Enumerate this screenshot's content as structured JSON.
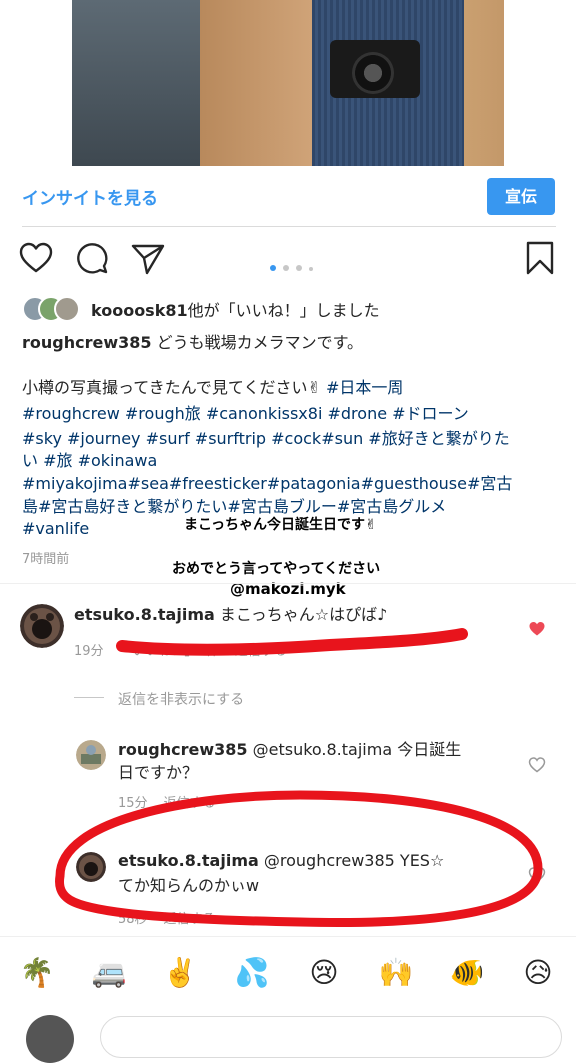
{
  "post": {
    "insights_label": "インサイトを見る",
    "promote_label": "宣伝",
    "liked_by_user": "koooosk81",
    "liked_by_suffix": "他が「いいね！」しました",
    "caption_user": "roughcrew385",
    "caption_first": " どうも戦場カメラマンです。",
    "caption_lines": [
      "小樽の写真撮ってきたんで見てください✌︎ ",
      "#日本一周",
      "#roughcrew #rough旅 #canonkissx8i #drone #ドローン",
      "#sky #journey #surf #surftrip #cock#sun #旅好きと繋がりた",
      "い #旅 #okinawa",
      "#miyakojima#sea#freesticker#patagonia#guesthouse#宮古",
      "島#宮古島好きと繋がりたい#宮古島ブルー#宮古島グルメ",
      "#vanlife"
    ],
    "time_ago": "7時間前"
  },
  "overlay": {
    "line1": "まこっちゃん今日誕生日です✌︎",
    "line2": "おめでとう言ってやってください",
    "line3": "@makozi.myk"
  },
  "comments": [
    {
      "user": "etsuko.8.tajima",
      "text": " まこっちゃん☆はぴば♪",
      "time": "19分",
      "likes": "「いいね！」1件",
      "reply": "返信する",
      "liked": true
    }
  ],
  "hide_replies_label": "返信を非表示にする",
  "replies": [
    {
      "user": "roughcrew385",
      "text1": " @etsuko.8.tajima 今日誕生",
      "text2": "日ですか？",
      "time": "15分",
      "reply": "返信する"
    },
    {
      "user": "etsuko.8.tajima",
      "text1": " @roughcrew385 YES☆",
      "text2": "てか知らんのかぃw",
      "time": "58秒",
      "reply": "返信する"
    }
  ],
  "emoji_bar": [
    "🌴",
    "🚐",
    "✌️",
    "💦",
    "😢",
    "🙌",
    "🐠",
    "😥"
  ],
  "colors": {
    "accent": "#3897f0",
    "heart_red": "#ed4956",
    "annotation_red": "#e8141c",
    "meta_gray": "#999999"
  },
  "icons": [
    "heart-icon",
    "comment-icon",
    "share-icon",
    "bookmark-icon",
    "heart-filled-icon",
    "heart-outline-icon"
  ]
}
